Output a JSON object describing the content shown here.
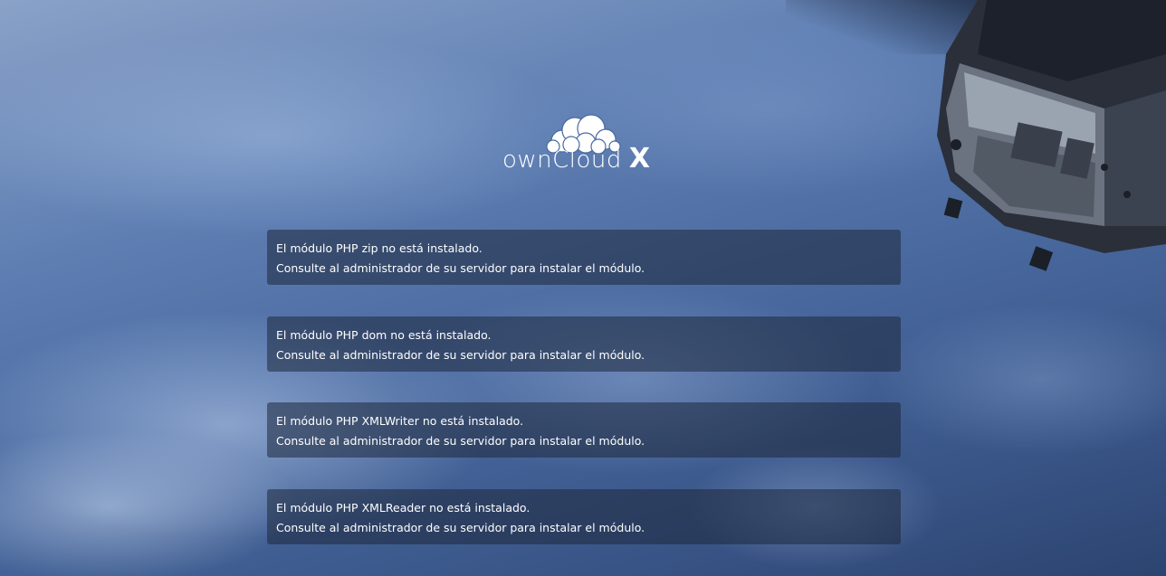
{
  "logo": {
    "wordmark": "ownCloud",
    "suffix": "X"
  },
  "colors": {
    "message_bg": "#1e283c",
    "text": "#ffffff"
  },
  "messages": [
    {
      "title": "El módulo PHP zip no está instalado.",
      "hint": "Consulte al administrador de su servidor para instalar el módulo."
    },
    {
      "title": "El módulo PHP dom no está instalado.",
      "hint": "Consulte al administrador de su servidor para instalar el módulo."
    },
    {
      "title": "El módulo PHP XMLWriter no está instalado.",
      "hint": "Consulte al administrador de su servidor para instalar el módulo."
    },
    {
      "title": "El módulo PHP XMLReader no está instalado.",
      "hint": "Consulte al administrador de su servidor para instalar el módulo."
    }
  ]
}
